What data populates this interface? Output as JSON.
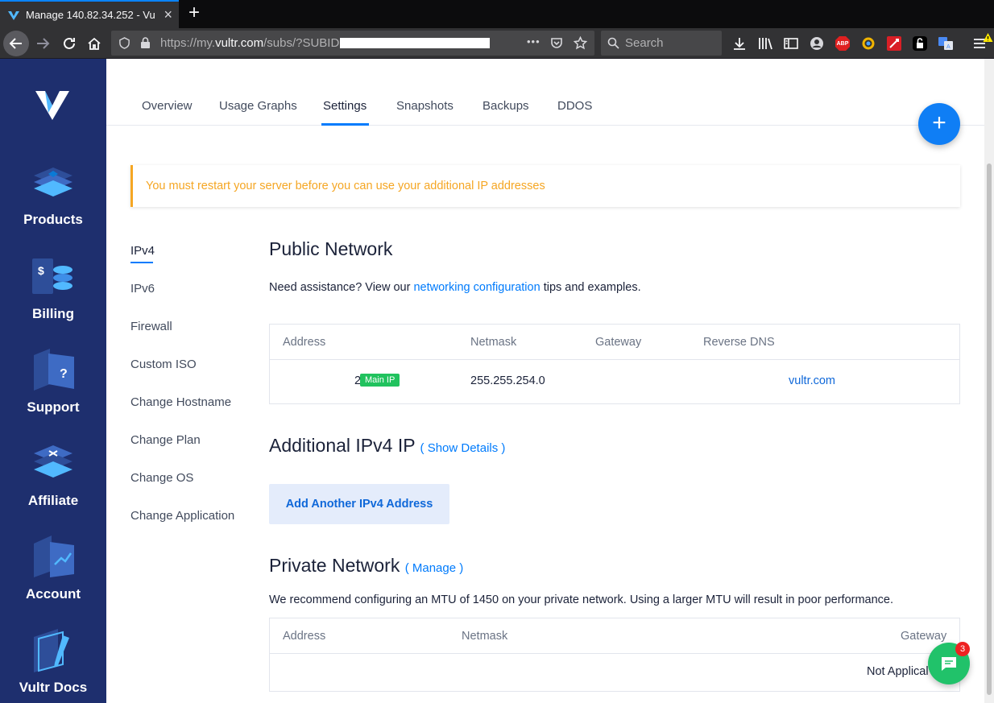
{
  "browser": {
    "tab_title": "Manage 140.82.34.252 - Vu",
    "new_tab": "+",
    "close_tab": "×",
    "url_scheme": "https://my.",
    "url_domain": "vultr.com",
    "url_path": "/subs/?SUBID",
    "page_actions": "•••",
    "search_placeholder": "Search",
    "toolbar_icons": [
      "downloads-icon",
      "library-icon",
      "sidebar-icon",
      "account-icon",
      "adblock-plus-icon",
      "extension-icon",
      "extension-red-icon",
      "lock-extension-icon",
      "translate-icon",
      "menu-icon"
    ],
    "abp_label": "ABP"
  },
  "sidebar": {
    "items": [
      {
        "label": "Products"
      },
      {
        "label": "Billing"
      },
      {
        "label": "Support"
      },
      {
        "label": "Affiliate"
      },
      {
        "label": "Account"
      },
      {
        "label": "Vultr Docs"
      }
    ]
  },
  "tabs": [
    "Overview",
    "Usage Graphs",
    "Settings",
    "Snapshots",
    "Backups",
    "DDOS"
  ],
  "active_tab": "Settings",
  "fab_label": "+",
  "alert": "You must restart your server before you can use your additional IP addresses",
  "subnav": [
    "IPv4",
    "IPv6",
    "Firewall",
    "Custom ISO",
    "Change Hostname",
    "Change Plan",
    "Change OS",
    "Change Application"
  ],
  "public_network": {
    "title": "Public Network",
    "help_prefix": "Need assistance? View our ",
    "help_link": "networking configuration",
    "help_suffix": " tips and examples.",
    "headers": [
      "Address",
      "Netmask",
      "Gateway",
      "Reverse DNS"
    ],
    "row": {
      "address_fragment": "2",
      "badge": "Main IP",
      "netmask": "255.255.254.0",
      "reverse_dns_fragment": "vultr.com"
    }
  },
  "additional": {
    "title": "Additional IPv4 IP",
    "show_details": "( Show Details )",
    "add_button": "Add Another IPv4 Address"
  },
  "private_network": {
    "title": "Private Network",
    "manage": "( Manage )",
    "note": "We recommend configuring an MTU of 1450 on your private network. Using a larger MTU will result in poor performance.",
    "headers": [
      "Address",
      "Netmask",
      "Gateway"
    ],
    "row_text": "Not Applical"
  },
  "chat": {
    "badge_count": "3"
  },
  "colors": {
    "sidebar": "#1e2f6e",
    "accent": "#007bfc",
    "alert": "#f5a623",
    "badge": "#21c25e",
    "chat": "#21c26a"
  }
}
